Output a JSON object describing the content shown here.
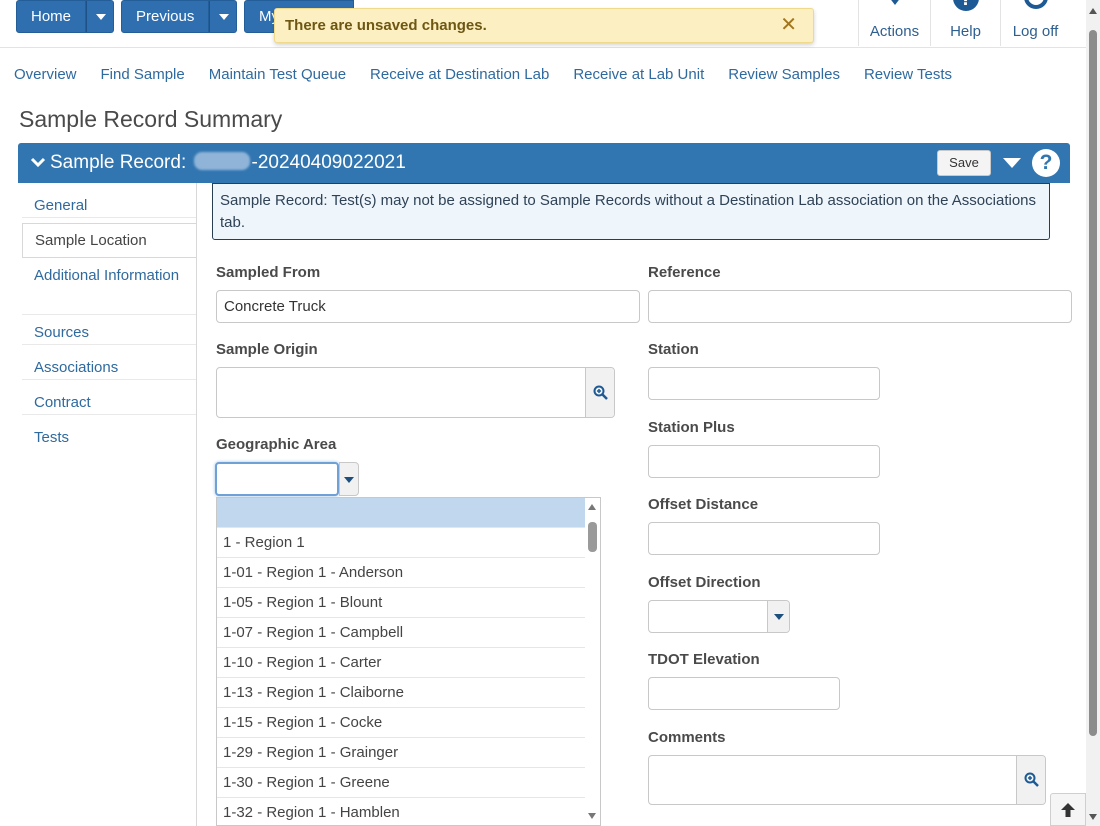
{
  "topbar": {
    "home_label": "Home",
    "previous_label": "Previous",
    "my_label": "My",
    "notification": "There are unsaved changes.",
    "close_symbol": "✕",
    "actions_label": "Actions",
    "help_label": "Help",
    "logoff_label": "Log off"
  },
  "nav": {
    "links": [
      "Overview",
      "Find Sample",
      "Maintain Test Queue",
      "Receive at Destination Lab",
      "Receive at Lab Unit",
      "Review Samples",
      "Review Tests"
    ]
  },
  "page": {
    "title": "Sample Record Summary",
    "record_prefix": "Sample Record:",
    "record_suffix": "-20240409022021",
    "save_label": "Save",
    "help_symbol": "?"
  },
  "sidebar": {
    "items": [
      {
        "label": "General"
      },
      {
        "label": "Sample Location"
      },
      {
        "label": "Additional Information"
      },
      {
        "label": "Sources"
      },
      {
        "label": "Associations"
      },
      {
        "label": "Contract"
      },
      {
        "label": "Tests"
      }
    ],
    "active": "Sample Location"
  },
  "info": {
    "message": "Sample Record: Test(s) may not be assigned to Sample Records without a Destination Lab association on the Associations tab."
  },
  "form": {
    "sampled_from_label": "Sampled From",
    "sampled_from_value": "Concrete Truck",
    "reference_label": "Reference",
    "reference_value": "",
    "sample_origin_label": "Sample Origin",
    "station_label": "Station",
    "station_plus_label": "Station Plus",
    "geographic_area_label": "Geographic Area",
    "geographic_area_value": "",
    "offset_distance_label": "Offset Distance",
    "offset_direction_label": "Offset Direction",
    "tdot_elevation_label": "TDOT Elevation",
    "comments_label": "Comments"
  },
  "dropdown": {
    "options": [
      "",
      "1 - Region 1",
      "1-01 - Region 1 - Anderson",
      "1-05 - Region 1 - Blount",
      "1-07 - Region 1 - Campbell",
      "1-10 - Region 1 - Carter",
      "1-13 - Region 1 - Claiborne",
      "1-15 - Region 1 - Cocke",
      "1-29 - Region 1 - Grainger",
      "1-30 - Region 1 - Greene",
      "1-32 - Region 1 - Hamblen"
    ]
  },
  "colors": {
    "primary": "#2f6fb0",
    "header_bar": "#3276b1",
    "notification_bg": "#fcf0c2",
    "link": "#2f6a9f"
  }
}
